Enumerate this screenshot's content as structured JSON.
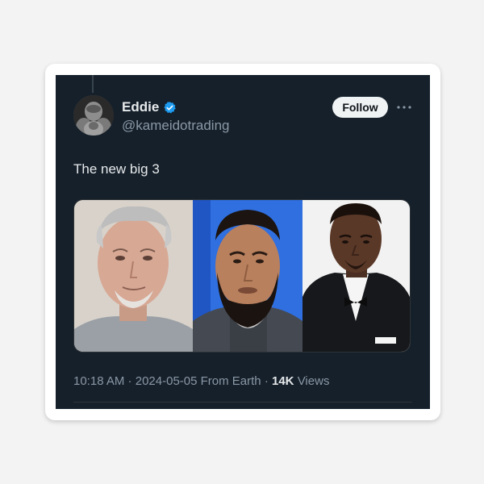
{
  "author": {
    "name": "Eddie",
    "handle": "@kameidotrading",
    "verified": true,
    "verified_color": "#1d9bf0",
    "avatar_icon": "avatar-photo"
  },
  "actions": {
    "follow_label": "Follow",
    "more_icon": "more-horizontal-icon"
  },
  "tweet": {
    "text": "The new big 3"
  },
  "media": {
    "photo_count": 3
  },
  "meta": {
    "time": "10:18 AM",
    "sep1": " · ",
    "date": "2024-05-05",
    "location": " From Earth",
    "sep2": " · ",
    "views_count": "14K",
    "views_label": " Views"
  },
  "colors": {
    "background": "#15202b",
    "text_primary": "#e7e9ea",
    "text_secondary": "#8b98a5",
    "follow_bg": "#eff3f4"
  }
}
